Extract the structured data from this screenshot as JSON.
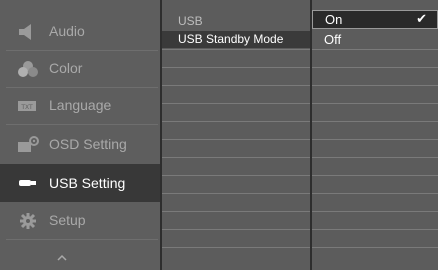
{
  "left_menu": {
    "items": [
      {
        "label": "Audio",
        "icon": "speaker-icon",
        "active": false
      },
      {
        "label": "Color",
        "icon": "color-palette-icon",
        "active": false
      },
      {
        "label": "Language",
        "icon": "language-icon",
        "active": false
      },
      {
        "label": "OSD Setting",
        "icon": "osd-setting-icon",
        "active": false
      },
      {
        "label": "USB Setting",
        "icon": "usb-icon",
        "active": true
      },
      {
        "label": "Setup",
        "icon": "gear-icon",
        "active": false
      }
    ],
    "scroll_up_icon": "chevron-up-icon"
  },
  "middle_menu": {
    "items": [
      {
        "label": "USB",
        "selected": false
      },
      {
        "label": "USB Standby Mode",
        "selected": true
      }
    ]
  },
  "options": {
    "items": [
      {
        "label": "On",
        "selected": true
      },
      {
        "label": "Off",
        "selected": false
      }
    ],
    "checkmark": "✔"
  },
  "colors": {
    "background": "#5c5c5c",
    "active_item": "#383838",
    "text_dim": "#a9a9a9",
    "text_active": "#ffffff"
  }
}
